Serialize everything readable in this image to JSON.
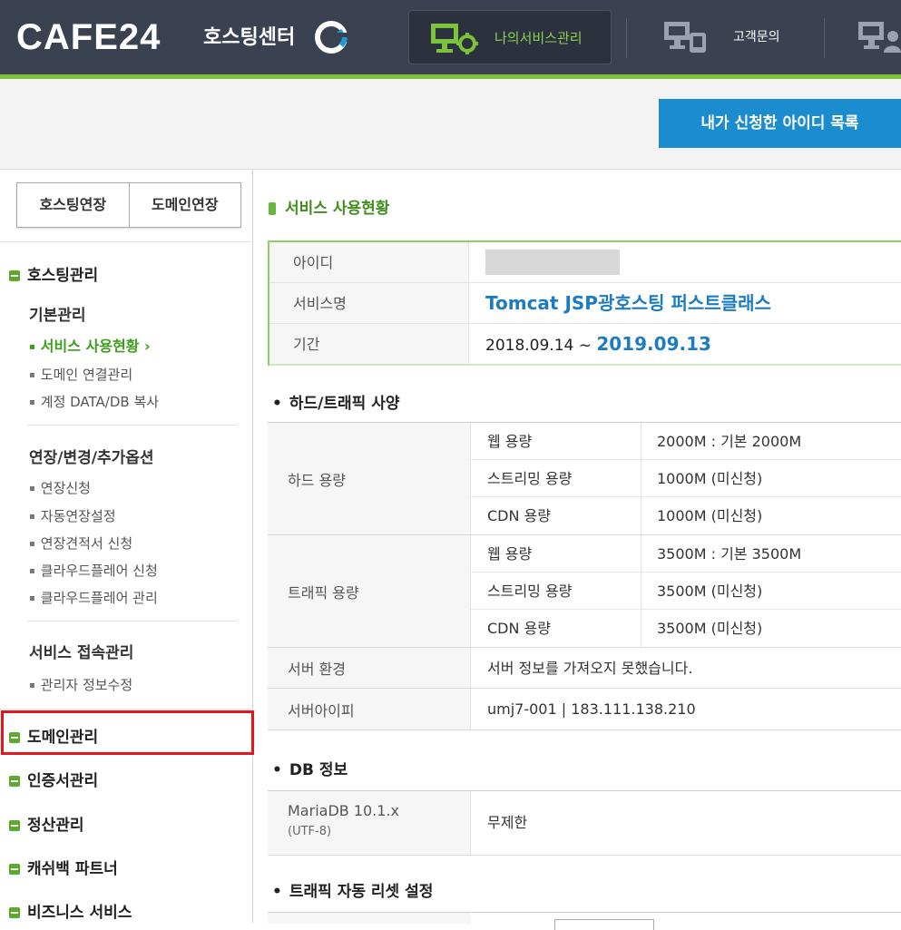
{
  "header": {
    "logo": "CAFE24",
    "logo_sub": "호스팅센터",
    "nav": [
      {
        "label": "나의서비스관리",
        "icon": "monitor-gear-icon",
        "active": true
      },
      {
        "label": "고객문의",
        "icon": "monitor-phone-icon",
        "active": false
      },
      {
        "label": "",
        "icon": "monitor-person-icon",
        "active": false
      }
    ],
    "accent": "#7cc23a"
  },
  "subheader": {
    "id_list_button": "내가 신청한 아이디 목록"
  },
  "sidebar": {
    "extend_buttons": [
      "호스팅연장",
      "도메인연장"
    ],
    "hosting_title": "호스팅관리",
    "basic_title": "기본관리",
    "basic_items": [
      "서비스 사용현황",
      "도메인 연결관리",
      "계정 DATA/DB 복사"
    ],
    "extension_title": "연장/변경/추가옵션",
    "extension_items": [
      "연장신청",
      "자동연장설정",
      "연장견적서 신청",
      "클라우드플레어 신청",
      "클라우드플레어 관리"
    ],
    "access_title": "서비스 접속관리",
    "access_items": [
      "관리자 정보수정"
    ],
    "categories": [
      "도메인관리",
      "인증서관리",
      "정산관리",
      "캐쉬백 파트너",
      "비즈니스 서비스"
    ]
  },
  "main": {
    "section_title": "서비스 사용현황",
    "info": {
      "id_label": "아이디",
      "service_label": "서비스명",
      "service_value": "Tomcat JSP광호스팅 퍼스트클래스",
      "period_label": "기간",
      "period_start": "2018.09.14 ~",
      "period_end": "2019.09.13"
    },
    "spec_title": "하드/트래픽 사양",
    "hard": {
      "label": "하드 용량",
      "rows": [
        {
          "k": "웹 용량",
          "v": "2000M : 기본 2000M"
        },
        {
          "k": "스트리밍 용량",
          "v": "1000M (미신청)"
        },
        {
          "k": "CDN 용량",
          "v": "1000M (미신청)"
        }
      ]
    },
    "traffic": {
      "label": "트래픽 용량",
      "rows": [
        {
          "k": "웹 용량",
          "v": "3500M : 기본 3500M"
        },
        {
          "k": "스트리밍 용량",
          "v": "3500M (미신청)"
        },
        {
          "k": "CDN 용량",
          "v": "3500M (미신청)"
        }
      ]
    },
    "server_env_label": "서버 환경",
    "server_env_value": "서버 정보를 가져오지 못했습니다.",
    "server_ip_label": "서버아이피",
    "server_ip_value": "umj7-001 | 183.111.138.210",
    "db_title": "DB 정보",
    "db_name": "MariaDB 10.1.x",
    "db_encoding": "(UTF-8)",
    "db_value": "무제한",
    "reset_title": "트래픽 자동 리셋 설정"
  }
}
